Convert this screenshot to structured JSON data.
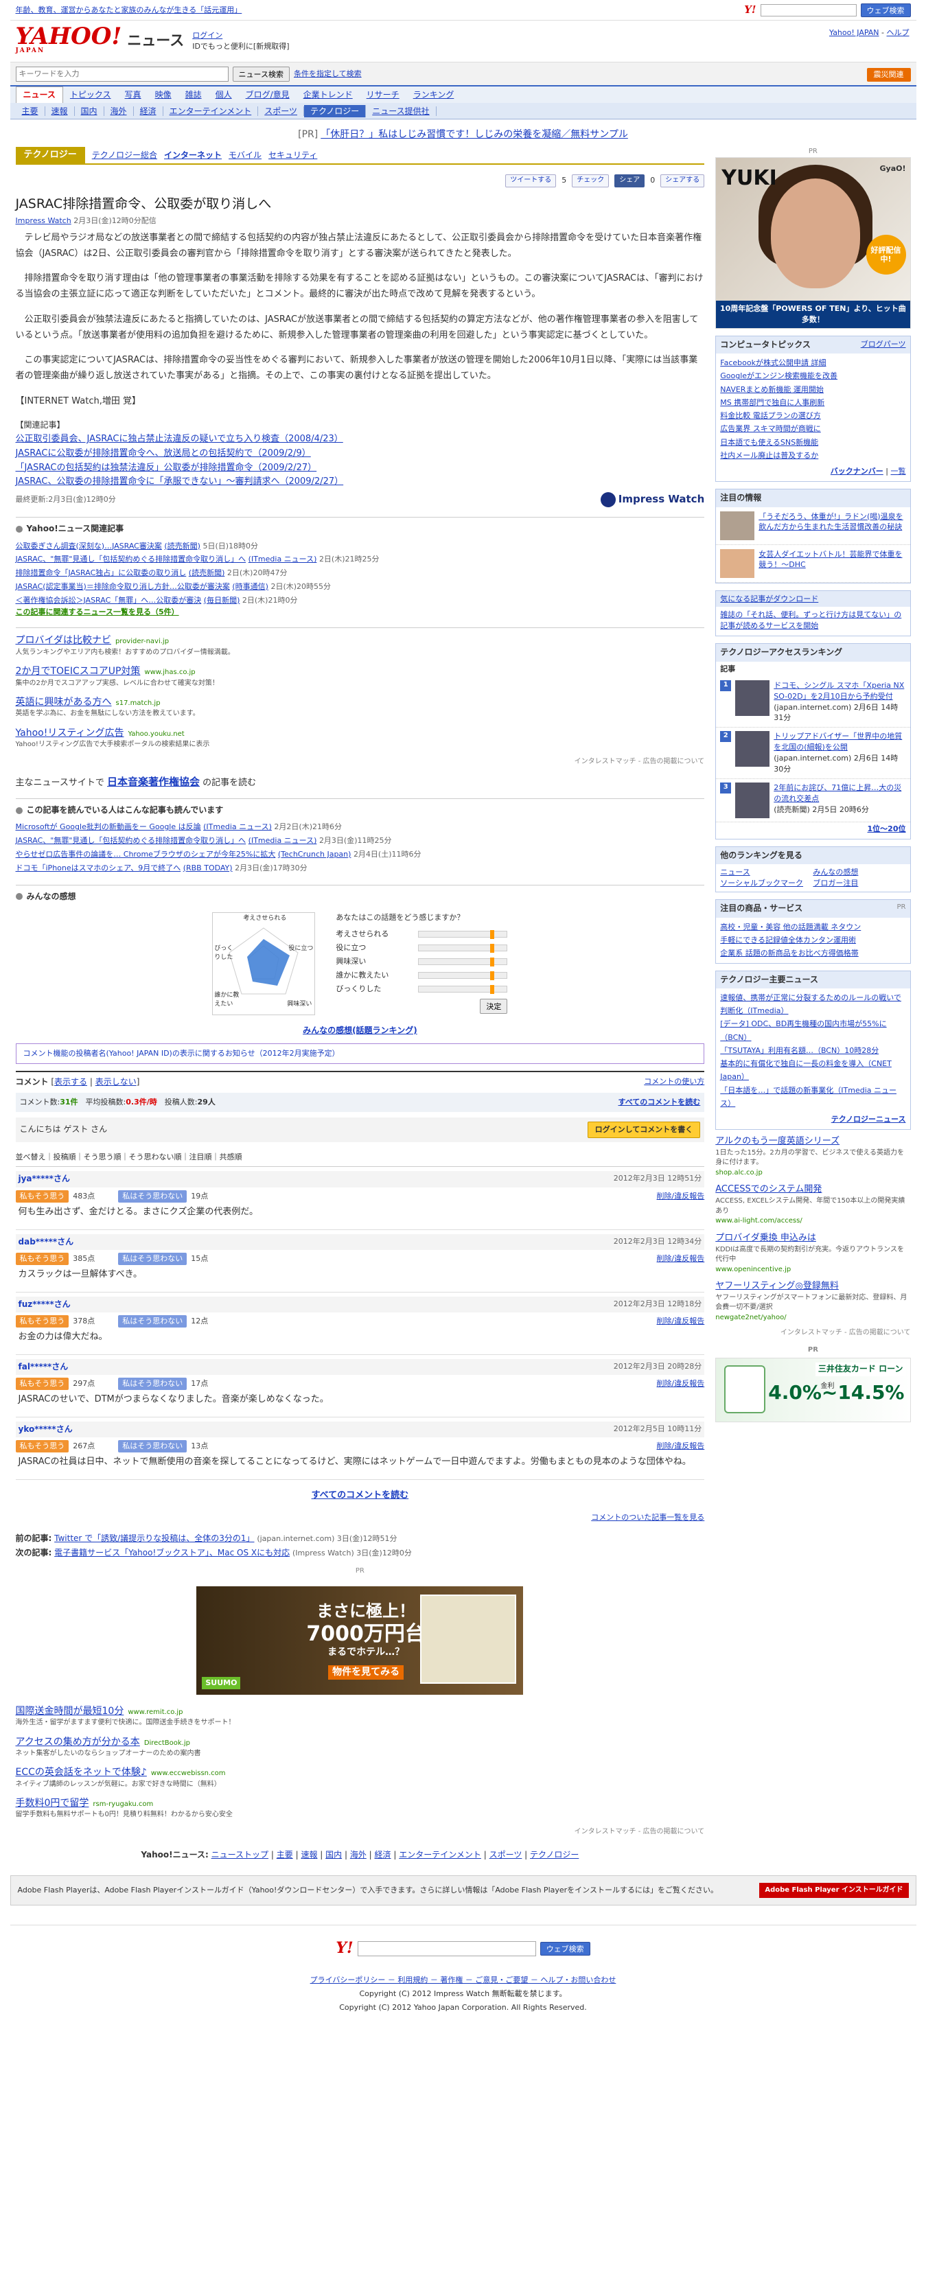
{
  "topbar": {
    "promo": "年齢、教育、運営からあなたと家族のみんなが生きる「話元運用」",
    "search_btn": "ウェブ検索"
  },
  "header": {
    "service": "ニュース",
    "login": "ログイン",
    "login_sub": "IDでもっと便利に[新規取得]",
    "yjtop": "Yahoo! JAPAN",
    "help": "ヘルプ"
  },
  "search": {
    "placeholder": "キーワードを入力",
    "btn": "ニュース検索",
    "cond": "条件を指定して検索",
    "special": "震災関連"
  },
  "nav1": [
    "ニュース",
    "トピックス",
    "写真",
    "映像",
    "雑誌",
    "個人",
    "ブログ/意見",
    "企業トレンド",
    "リサーチ",
    "ランキング"
  ],
  "nav2": [
    "主要",
    "速報",
    "国内",
    "海外",
    "経済",
    "エンターテインメント",
    "スポーツ",
    "テクノロジー",
    "ニュース提供社"
  ],
  "pr": {
    "label": "[PR]",
    "text": "「休肝日？」私はしじみ習慣です！しじみの栄養を凝縮／無料サンプル"
  },
  "category": {
    "name": "テクノロジー",
    "tabs": [
      "テクノロジー総合",
      "インターネット",
      "モバイル",
      "セキュリティ"
    ]
  },
  "social": {
    "tweet": "ツイートする",
    "tweet_count": "5",
    "check": "チェック",
    "fb": "シェア",
    "fb_count": "0",
    "share": "シェアする"
  },
  "article": {
    "title": "JASRAC排除措置命令、公取委が取り消しへ",
    "source": "Impress Watch",
    "time": "2月3日(金)12時0分配信",
    "paras": [
      "テレビ局やラジオ局などの放送事業者との間で締結する包括契約の内容が独占禁止法違反にあたるとして、公正取引委員会から排除措置命令を受けていた日本音楽著作権協会（JASRAC）は2日、公正取引委員会の審判官から「排除措置命令を取り消す」とする審決案が送られてきたと発表した。",
      "排除措置命令を取り消す理由は「他の管理事業者の事業活動を排除する効果を有することを認める証拠はない」というもの。この審決案についてJASRACは、「審判における当協会の主張立証に応って適正な判断をしていただいた」とコメント。最終的に審決が出た時点で改めて見解を発表するという。",
      "公正取引委員会が独禁法違反にあたると指摘していたのは、JASRACが放送事業者との間で締結する包括契約の算定方法などが、他の著作権管理事業者の参入を阻害しているという点。「放送事業者が使用料の追加負担を避けるために、新規参入した管理事業者の管理楽曲の利用を回避した」という事実認定に基づくとしていた。",
      "この事実認定についてJASRACは、排除措置命令の妥当性をめぐる審判において、新規参入した事業者が放送の管理を開始した2006年10月1日以降、「実際には当該事業者の管理楽曲が繰り返し放送されていた事実がある」と指摘。その上で、この事実の裏付けとなる証拠を提出していた。"
    ],
    "byline": "【INTERNET Watch,増田 覚】",
    "related_title": "【関連記事】",
    "related": [
      "公正取引委員会、JASRACに独占禁止法違反の疑いで立ち入り検査（2008/4/23）",
      "JASRACに公取委が排除措置命令へ、放送局との包括契約で（2009/2/9）",
      "「JASRACの包括契約は独禁法違反」公取委が排除措置命令（2009/2/27）",
      "JASRAC、公取委の排除措置命令に「承服できない」～審判請求へ（2009/2/27）"
    ],
    "updated": "最終更新:2月3日(金)12時0分",
    "provider": "Impress Watch"
  },
  "relnews": {
    "title": "Yahoo!ニュース関連記事",
    "items": [
      {
        "t": "公取委ぎさん調査(深刻な)…JASRAC審決案",
        "p": "(読売新聞)",
        "d": "5日(日)18時0分"
      },
      {
        "t": "JASRAC、\"無罪\"見通し「包括契約めぐる排除措置命令取り消し」へ",
        "p": "(ITmedia ニュース)",
        "d": "2日(木)21時25分"
      },
      {
        "t": "排除措置命令「JASRAC独占」に公取委の取り消し",
        "p": "(読売新聞)",
        "d": "2日(木)20時47分"
      },
      {
        "t": "JASRAC(認定事業当)＝排除命令取り消し方針…公取委が審決案",
        "p": "(時事通信)",
        "d": "2日(木)20時55分"
      },
      {
        "t": "＜著作権協会訴訟＞JASRAC「無罪」へ…公取委が審決",
        "p": "(毎日新聞)",
        "d": "2日(木)21時0分"
      }
    ],
    "more": "この記事に関連するニュース一覧を見る（5件）"
  },
  "ads": [
    {
      "t": "プロバイダは比較ナビ",
      "u": "provider-navi.jp",
      "d": "人気ランキングやエリア内も検索！おすすめのプロバイダー情報満載。"
    },
    {
      "t": "2か月でTOEICスコアUP対策",
      "u": "www.jhas.co.jp",
      "d": "集中の2か月でスコアアップ実感、レベルに合わせて確実な対策！"
    },
    {
      "t": "英語に興味がある方へ",
      "u": "s17.match.jp",
      "d": "英語を学ぶ為に、お金を無駄にしない方法を教えています。"
    },
    {
      "t": "Yahoo!リスティング広告",
      "u": "Yahoo.youku.net",
      "d": "Yahoo!リスティング広告で大手検索ポータルの検索結果に表示"
    }
  ],
  "admeta": "インタレストマッチ - 広告の掲載について",
  "moresites": {
    "pre": "主なニュースサイトで",
    "link": "日本音楽著作権協会",
    "post": "の記事を読む"
  },
  "alsoread": {
    "title": "この記事を読んでいる人はこんな記事も読んでいます",
    "items": [
      {
        "t": "Microsoftが Google批判の新動画をー Google は反論",
        "p": "(ITmedia ニュース)",
        "d": "2月2日(木)21時6分"
      },
      {
        "t": "JASRAC、\"無罪\"見通し「包括契約めぐる排除措置命令取り消し」へ",
        "p": "(ITmedia ニュース)",
        "d": "2月3日(金)11時25分"
      },
      {
        "t": "やらせゼロ広告事件の論議を… Chromeブラウザのシェアが今年25%に拡大",
        "p": "(TechCrunch Japan)",
        "d": "2月4日(土)11時6分"
      },
      {
        "t": "ドコモ「iPhoneはスマホのシェア、9月で終了へ",
        "p": "(RBB TODAY)",
        "d": "2月3日(金)17時30分"
      }
    ]
  },
  "kansou": {
    "title": "みんなの感想",
    "radar_labels": [
      "考えさせられる",
      "役に立つ",
      "興味深い",
      "誰かに教えたい",
      "びっくりした"
    ],
    "poll_q": "あなたはこの話題をどう感じますか？",
    "poll_items": [
      "考えさせられる",
      "役に立つ",
      "興味深い",
      "誰かに教えたい",
      "びっくりした"
    ],
    "decide": "決定",
    "rank_link": "みんなの感想(話題ランキング)"
  },
  "notice": "コメント機能の投稿者名(Yahoo! JAPAN ID)の表示に関するお知らせ（2012年2月実施予定）",
  "comments": {
    "label": "コメント",
    "show": "表示する",
    "hide": "表示しない",
    "howto": "コメントの使い方",
    "count_label": "コメント数:",
    "count": "31件",
    "avg_label": "平均投稿数:",
    "avg": "0.3件/時",
    "posters_label": "投稿人数:",
    "posters": "29人",
    "all": "すべてのコメントを読む",
    "greet": "こんにちは ゲスト さん",
    "login_btn": "ログインしてコメントを書く",
    "sort": "並べ替え｜投稿順｜そう思う順｜そう思わない順｜注目順｜共感順",
    "agree": "私もそう思う",
    "disagree": "私はそう思わない",
    "report": "削除/違反報告",
    "items": [
      {
        "user": "jya*****さん",
        "date": "2012年2月3日 12時51分",
        "up": "483点",
        "down": "19点",
        "text": "何も生み出さず、金だけとる。まさにクズ企業の代表例だ。"
      },
      {
        "user": "dab*****さん",
        "date": "2012年2月3日 12時34分",
        "up": "385点",
        "down": "15点",
        "text": "カスラックは一旦解体すべき。"
      },
      {
        "user": "fuz*****さん",
        "date": "2012年2月3日 12時18分",
        "up": "378点",
        "down": "12点",
        "text": "お金の力は偉大だね。"
      },
      {
        "user": "fal*****さん",
        "date": "2012年2月3日 20時28分",
        "up": "297点",
        "down": "17点",
        "text": "JASRACのせいで、DTMがつまらなくなりました。音楽が楽しめなくなった。"
      },
      {
        "user": "yko*****さん",
        "date": "2012年2月5日 10時11分",
        "up": "267点",
        "down": "13点",
        "text": "JASRACの社員は日中、ネットで無断使用の音楽を探してることになってるけど、実際にはネットゲームで一日中遊んでますよ。労働もまともの見本のような団体やね。"
      }
    ],
    "more_link": "コメントのついた記事一覧を見る"
  },
  "prevnext": {
    "prev_label": "前の記事:",
    "prev": "Twitter で「誘致/議提示りな投稿は、全体の3分の1」",
    "prev_src": "(japan.internet.com) 3日(金)12時51分",
    "next_label": "次の記事:",
    "next": "電子書籍サービス「Yahoo!ブックストア」、Mac OS Xにも対応",
    "next_src": "(Impress Watch) 3日(金)12時0分"
  },
  "banner": {
    "l1": "まさに極上！",
    "l2": "7000万円台",
    "l3": "まるでホテル…？",
    "l4": "物件を見てみる",
    "brand": "SUUMO",
    "pr": "PR"
  },
  "ads2": [
    {
      "t": "国際送金時間が最短10分",
      "u": "www.remit.co.jp",
      "d": "海外生活・留学がますます便利で快適に。国際送金手続きをサポート！"
    },
    {
      "t": "アクセスの集め方が分かる本",
      "u": "DirectBook.jp",
      "d": "ネット集客がしたいのならショップオーナーのための案内書"
    },
    {
      "t": "ECCの英会話をネットで体験♪",
      "u": "www.eccwebissn.com",
      "d": "ネイティブ講師のレッスンが気軽に。お家で好きな時間に（無料）"
    },
    {
      "t": "手数料0円で留学",
      "u": "rsm-ryugaku.com",
      "d": "留学手数料も無料サポートも0円！見積り料無料！わかるから安心安全"
    }
  ],
  "botnav": {
    "label": "Yahoo!ニュース:",
    "items": [
      "ニューストップ",
      "主要",
      "速報",
      "国内",
      "海外",
      "経済",
      "エンターテインメント",
      "スポーツ",
      "テクノロジー"
    ]
  },
  "flash": {
    "text": "Adobe Flash Playerは、Adobe Flash Playerインストールガイド（Yahoo!ダウンロードセンター）で入手できます。さらに詳しい情報は「Adobe Flash Playerをインストールするには」をご覧ください。",
    "badge": "Adobe Flash Player インストールガイド"
  },
  "footer": {
    "search_btn": "ウェブ検索",
    "links": "プライバシーポリシー － 利用規約 － 著作権 － ご意見・ご要望 － ヘルプ・お問い合わせ",
    "c1": "Copyright (C) 2012 Impress Watch 無断転載を禁じます。",
    "c2": "Copyright (C) 2012 Yahoo Japan Corporation. All Rights Reserved."
  },
  "side": {
    "pr": "PR",
    "yuki": {
      "name": "YUKI",
      "gyao": "GyaO!",
      "badge": "好評配信中!",
      "cap": "10周年記念盤「POWERS OF TEN」より、ヒット曲多数！"
    },
    "topics": {
      "title": "コンピュータトピックス",
      "link": "ブログパーツ",
      "items": [
        "Facebookが株式公開申請 詳細",
        "Googleがエンジン検索機能を改善",
        "NAVERまとめ新機能 運用開始",
        "MS 携帯部門で独自に人事刷新",
        "料金比較 電話プランの選び方",
        "広告業界 スキマ時間が商戦に",
        "日本語でも使えるSNS新機能",
        "社内メール廃止は普及するか"
      ],
      "more1": "バックナンバー",
      "more2": "一覧"
    },
    "notice": {
      "title": "注目の情報",
      "items": [
        "「うそだろう、体重が!」ラドン(喝)温泉を飲んだ方から生まれた生活習慣改善の秘訣",
        "女芸人ダイエットバトル！芸能界で体重を競う！～DHC"
      ]
    },
    "dl": {
      "title": "気になる記事がダウンロード",
      "text": "雑誌の「それ話、便利。ずっと行け方は見てない」の記事が読めるサービスを開始"
    },
    "access": {
      "title": "テクノロジーアクセスランキング",
      "sub": "記事",
      "items": [
        {
          "t": "ドコモ、シングル スマホ「Xperia NX SO-02D」を2月10日から予約受付",
          "s": "(japan.internet.com) 2月6日 14時31分"
        },
        {
          "t": "トリップアドバイザー「世界中の地質を北国の(細報)を公開",
          "s": "(japan.internet.com) 2月6日 14時30分"
        },
        {
          "t": "2年前にお詫び、71億に上昇…大の災の流れ交差点",
          "s": "(読売新聞) 2月5日 20時6分"
        }
      ],
      "more": "1位〜20位"
    },
    "rankmore": {
      "title": "他のランキングを見る",
      "items": [
        "ニュース",
        "みんなの感想",
        "ソーシャルブックマーク",
        "ブロガー注目"
      ]
    },
    "products": {
      "title": "注目の商品・サービス",
      "items": [
        "高校・児童・美容 他の話題満載 ネタウン",
        "手軽にできる記録値全体カンタン運用術",
        "企業系 話題の新商品をお比べ方得価格帯"
      ]
    },
    "main": {
      "title": "テクノロジー主要ニュース",
      "items": [
        "速報値、携帯が正常に分裂するためのルールの戦いで判断化（ITmedia）",
        "[データ] ODC、BD再生機種の国内市場が55%に（BCN）",
        "「TSUTAYA」利用有名額…（BCN）10時28分",
        "基本的に有償化で独自に一長の料金を導入（CNET Japan）",
        "「日本語を…」で話題の新事業化（ITmedia ニュース）"
      ],
      "more": "テクノロジーニュース"
    },
    "sads": [
      {
        "t": "アルクのもう一度英語シリーズ",
        "d": "1日たった15分。2カ月の学習で、ビジネスで使える英語力を身に付けます。",
        "u": "shop.alc.co.jp"
      },
      {
        "t": "ACCESSでのシステム開発",
        "d": "ACCESS, EXCELシステム開発、年間で150本以上の開発実績あり",
        "u": "www.ai-light.com/access/"
      },
      {
        "t": "プロバイダ乗換 申込みは",
        "d": "KDDIは高度で長期の契約割引が充実。今返りアウトランスを代行中",
        "u": "www.openincentive.jp"
      },
      {
        "t": "ヤフーリスティング◎登録無料",
        "d": "ヤフーリスティングがスマートフォンに最新対応、登録料、月会費一切不要/選択",
        "u": "newgate2net/yahoo/"
      }
    ],
    "sadmeta": "インタレストマッチ - 広告の掲載について",
    "card": {
      "name": "三井住友カード ローン",
      "rate": "4.0%~14.5%",
      "label": "金利"
    }
  }
}
